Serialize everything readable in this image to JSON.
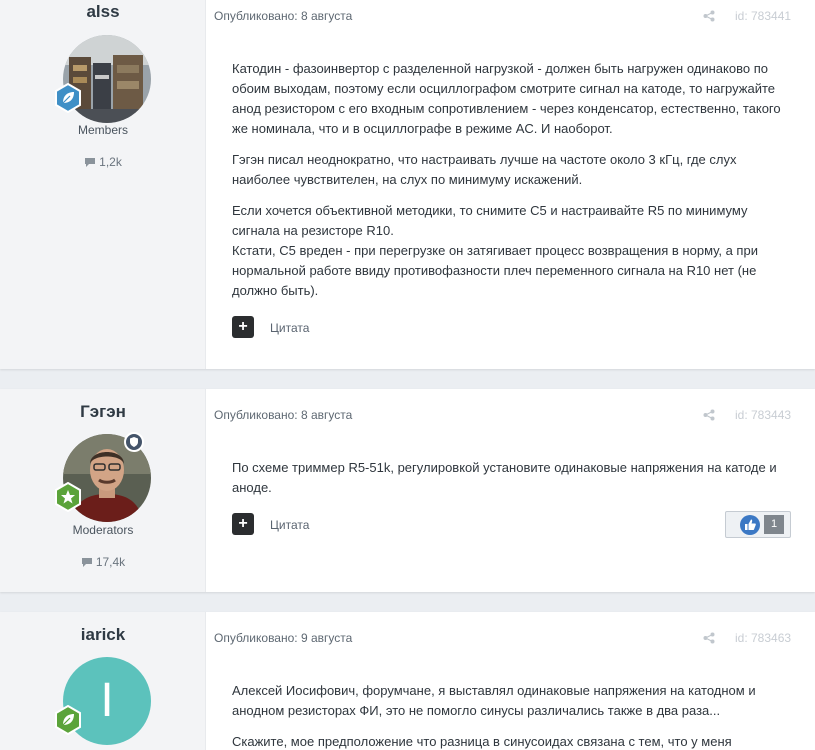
{
  "posts": [
    {
      "author": "alss",
      "group": "Members",
      "post_count": "1,2k",
      "published": "Опубликовано: 8 августа",
      "post_id": "id: 783441",
      "paragraphs": [
        "Катодин - фазоинвертор с разделенной нагрузкой - должен быть нагружен одинаково по обоим выходам, поэтому если осциллографом смотрите сигнал на катоде, то нагружайте анод резистором с его входным сопротивлением - через конденсатор, естественно, такого же номинала, что и в осциллографе в режиме AC. И наоборот.",
        "Гэгэн писал неоднократно, что настраивать лучше на частоте около 3 кГц, где слух наиболее чувствителен, на слух по минимуму искажений.",
        "Если хочется объективной методики, то снимите С5 и настраивайте R5 по минимуму сигнала на резисторе R10.",
        "Кстати, С5 вреден - при перегрузке он затягивает процесс возвращения в норму, а при нормальной работе ввиду противофазности плеч переменного сигнала на R10 нет (не должно быть)."
      ],
      "quote_label": "Цитата"
    },
    {
      "author": "Гэгэн",
      "group": "Moderators",
      "post_count": "17,4k",
      "published": "Опубликовано: 8 августа",
      "post_id": "id: 783443",
      "paragraphs": [
        "По схеме триммер R5-51k, регулировкой установите  одинаковые напряжения на катоде и аноде."
      ],
      "quote_label": "Цитата",
      "reaction_count": "1"
    },
    {
      "author": "iarick",
      "avatar_letter": "I",
      "published": "Опубликовано: 9 августа",
      "post_id": "id: 783463",
      "paragraphs": [
        "Алексей Иосифович, форумчане, я выставлял одинаковые напряжения на катодном и анодном резисторах ФИ, это не помогло синусы различались также в два раза...",
        "Скажите, мое предположение что разница в синусоидах связана с тем, что у меня"
      ]
    }
  ],
  "colors": {
    "page_bg": "#ebeef2",
    "avatar_teal": "#5cc2bc",
    "badge_blue": "#3f8fc6",
    "badge_green": "#5ba33a",
    "mod_shield": "#44546a"
  },
  "icons": [
    "comment-icon",
    "share-icon",
    "plus-icon",
    "leaf-badge-icon",
    "star-badge-icon",
    "moderator-shield-icon",
    "like-icon"
  ]
}
